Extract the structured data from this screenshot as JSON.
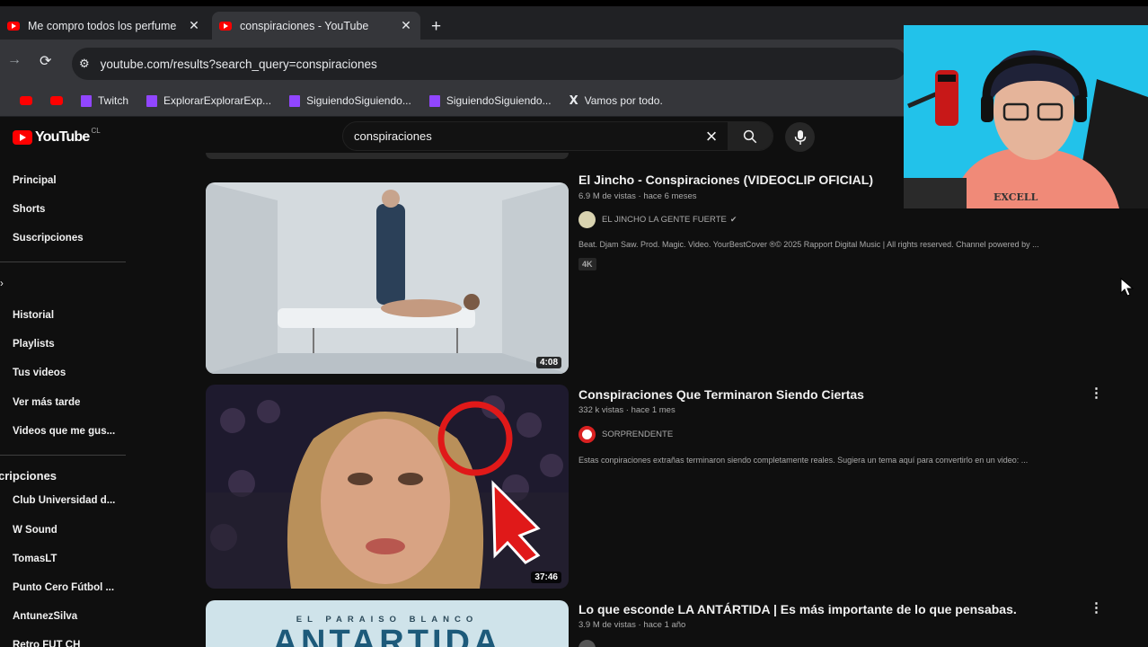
{
  "browser": {
    "tabs": [
      {
        "title": "Me compro todos los perfume",
        "active": false
      },
      {
        "title": "conspiraciones - YouTube",
        "active": true
      }
    ],
    "url": "youtube.com/results?search_query=conspiraciones",
    "bookmarks": [
      {
        "label": "",
        "icon": "youtube-icon"
      },
      {
        "label": "",
        "icon": "youtube-icon"
      },
      {
        "label": "Twitch",
        "icon": "twitch-icon"
      },
      {
        "label": "ExplorarExplorarExp...",
        "icon": "twitch-icon"
      },
      {
        "label": "SiguiendoSiguiendo...",
        "icon": "twitch-icon"
      },
      {
        "label": "SiguiendoSiguiendo...",
        "icon": "twitch-icon"
      },
      {
        "label": "Vamos por todo.",
        "icon": "x-icon"
      }
    ]
  },
  "youtube": {
    "logo_text": "YouTube",
    "country": "CL",
    "search_query": "conspiraciones",
    "sidebar": {
      "top": [
        "Principal",
        "Shorts",
        "Suscripciones"
      ],
      "you": [
        "Historial",
        "Playlists",
        "Tus videos",
        "Ver más tarde",
        "Videos que me gus..."
      ],
      "subs_heading": "cripciones",
      "subs": [
        "Club Universidad d...",
        "W Sound",
        "TomasLT",
        "Punto Cero Fútbol ...",
        "AntunezSilva",
        "Retro FUT CH"
      ]
    },
    "results": [
      {
        "title": "El Jincho - Conspiraciones (VIDEOCLIP OFICIAL)",
        "meta": "6.9 M de vistas · hace 6 meses",
        "channel": "EL JINCHO LA GENTE FUERTE",
        "verified": true,
        "description": "Beat. Djam Saw. Prod. Magic. Video. YourBestCover ®© 2025 Rapport Digital Music | All rights reserved. Channel powered by ...",
        "badge": "4K",
        "duration": "4:08"
      },
      {
        "title": "Conspiraciones Que Terminaron Siendo Ciertas",
        "meta": "332 k vistas · hace 1 mes",
        "channel": "SORPRENDENTE",
        "verified": false,
        "description": "Estas conpiraciones extrañas terminaron siendo completamente reales. Sugiera un tema aquí para convertirlo en un video: ...",
        "duration": "37:46"
      },
      {
        "title": "Lo que esconde LA ANTÁRTIDA | Es más importante de lo que pensabas.",
        "meta": "3.9 M de vistas · hace 1 año",
        "thumb_text_top": "EL PARAISO BLANCO",
        "thumb_text_big": "ANTARTIDA"
      }
    ]
  },
  "colors": {
    "youtube_red": "#ff0000",
    "twitch_purple": "#9146ff",
    "cam_bg": "#22c2ea"
  }
}
